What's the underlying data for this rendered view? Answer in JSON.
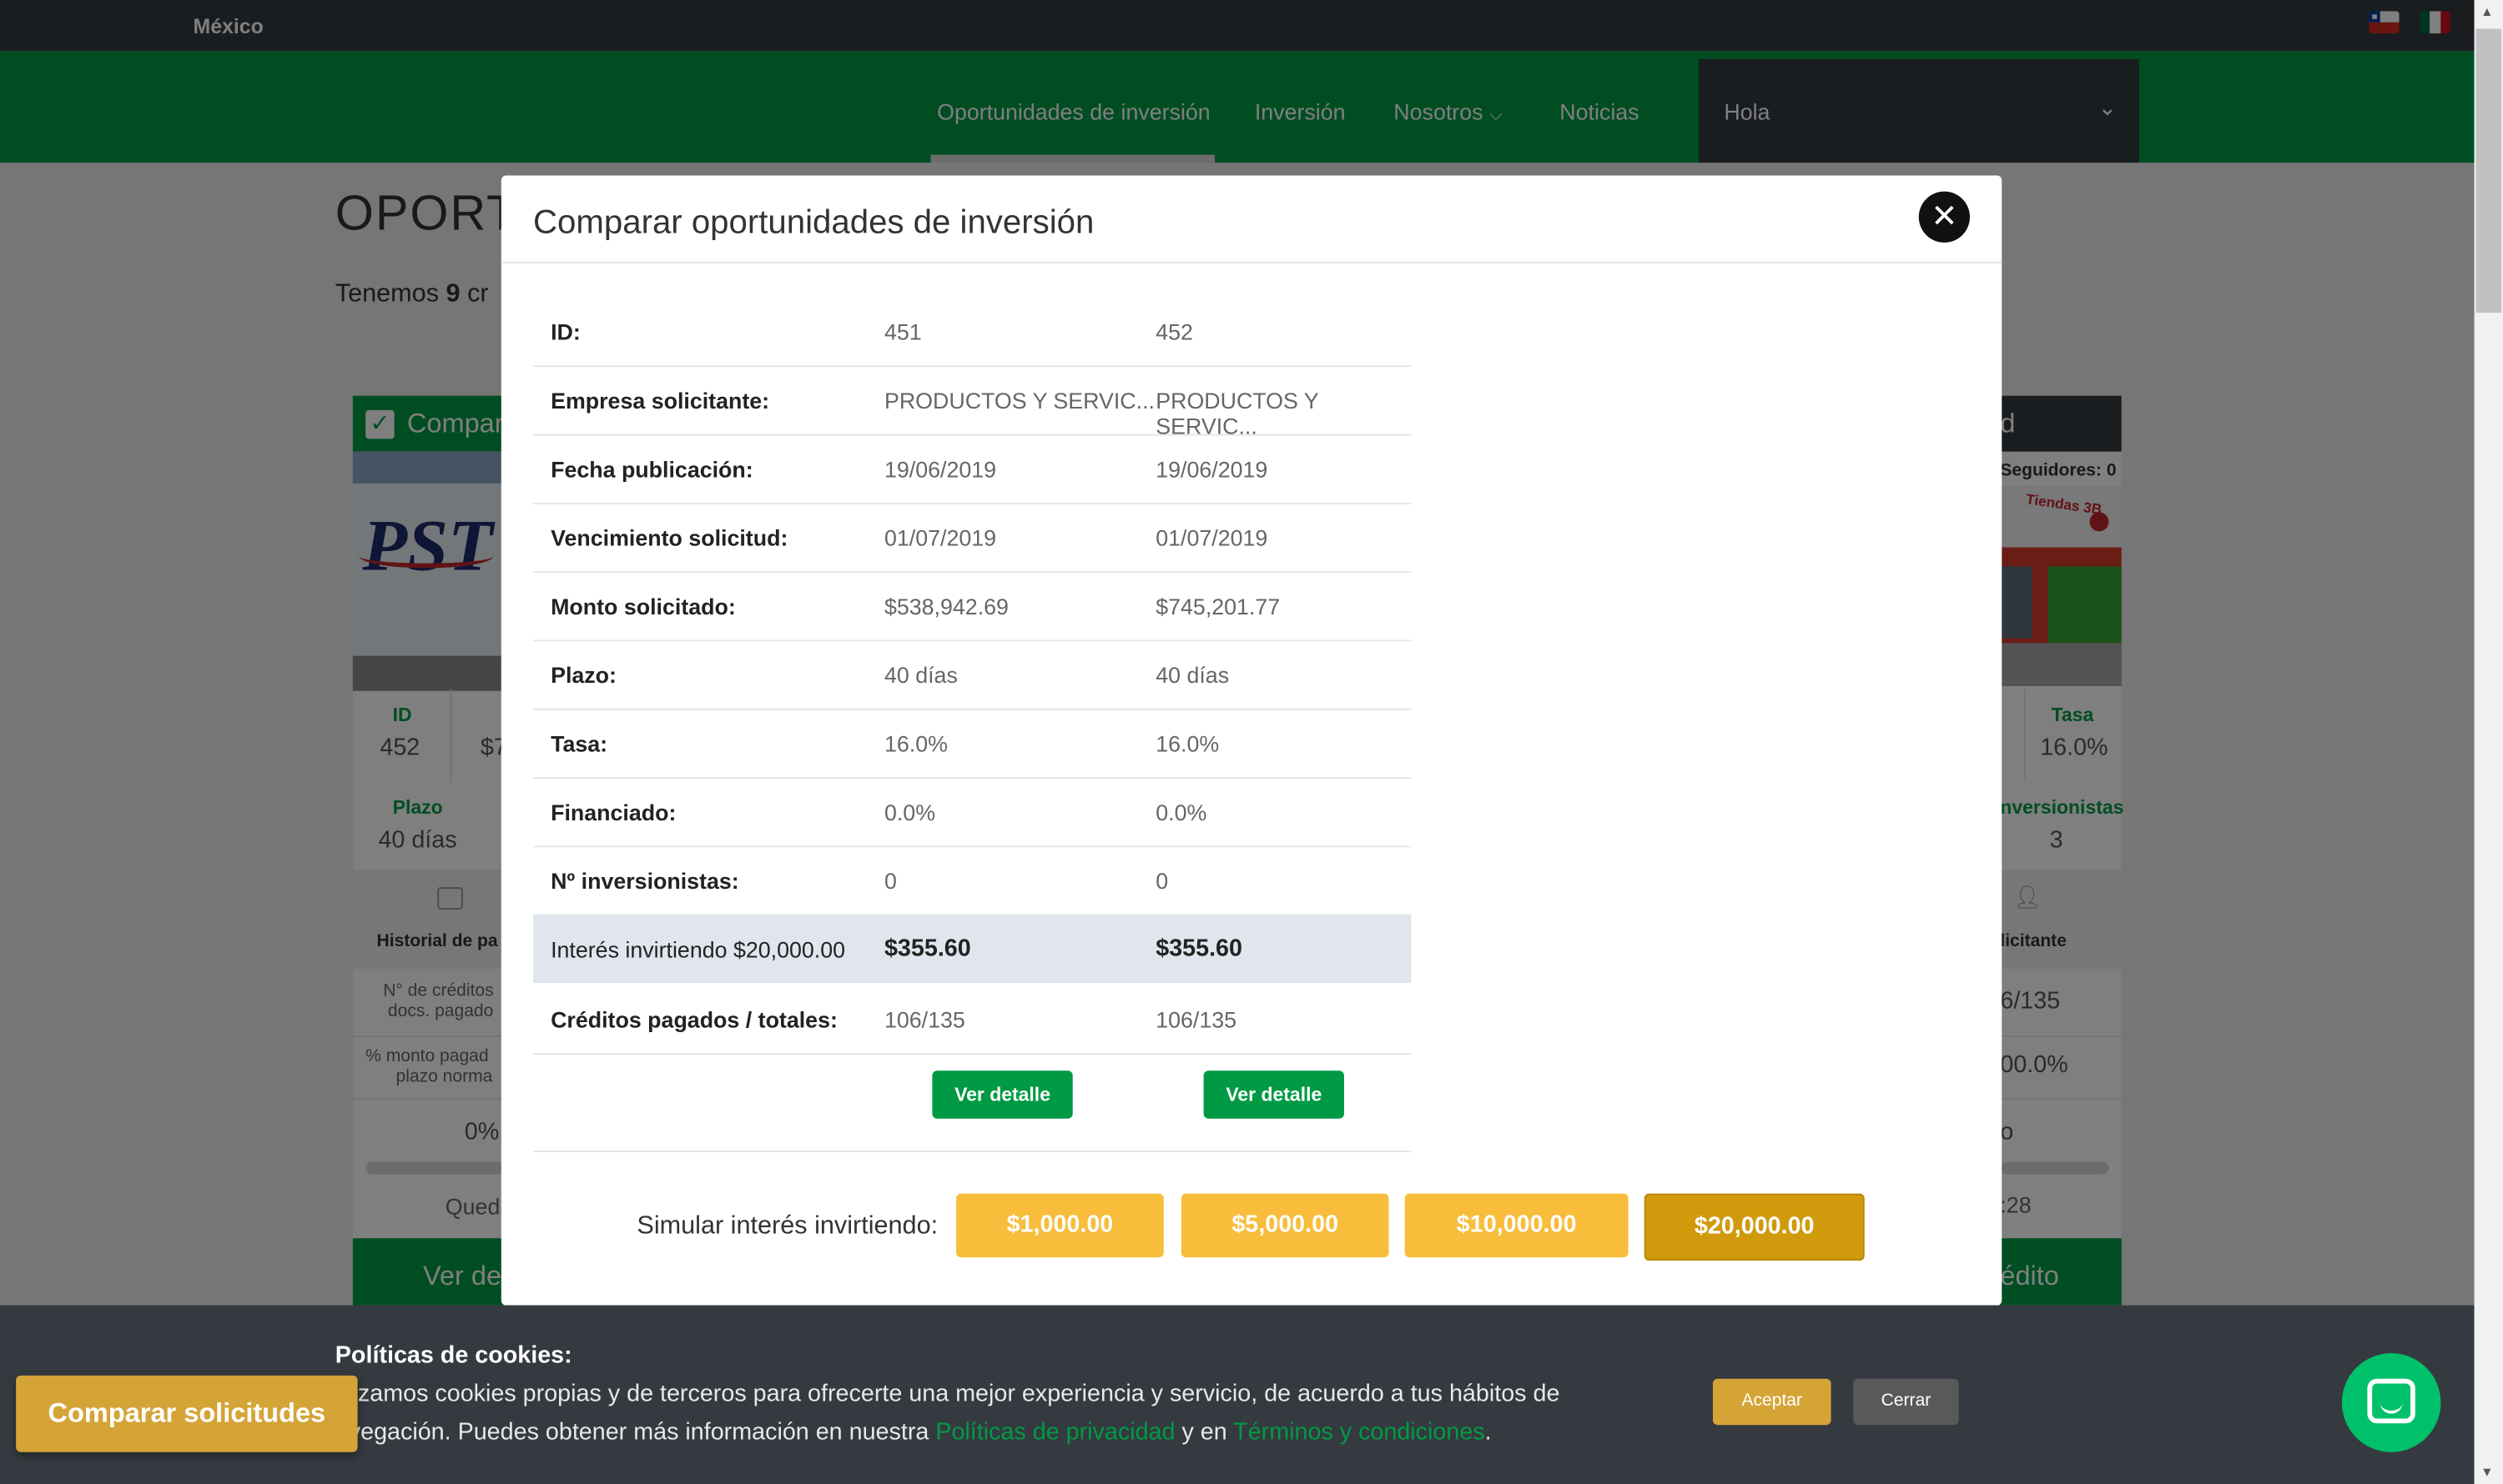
{
  "topbar": {
    "country": "México"
  },
  "nav": {
    "items": [
      {
        "label": "Oportunidades de inversión"
      },
      {
        "label": "Inversión"
      },
      {
        "label": "Nosotros"
      },
      {
        "label": "Noticias"
      }
    ],
    "user_menu_label": "Hola"
  },
  "page": {
    "heading_partial": "OPORT",
    "sub_prefix": "Tenemos ",
    "sub_count": "9",
    "sub_suffix": " cr",
    "left_card": {
      "header": "Compar",
      "id_label": "ID",
      "id_value": "452",
      "amount_partial": "$7",
      "plazo_label": "Plazo",
      "plazo_value": "40 días",
      "historial_label": "Historial de pa",
      "docs_label_1": "N° de créditos",
      "docs_label_2": "docs. pagado",
      "monto_label_1": "% monto pagad",
      "monto_label_2": "plazo norma",
      "percent": "0%",
      "queda": "Queda",
      "ver": "Ver de"
    },
    "right_card": {
      "header": "d",
      "seguidores": "Seguidores: 0",
      "tasa_label": "Tasa",
      "tasa_value": "16.0%",
      "inv_label": "nversionistas",
      "inv_value": "3",
      "solicitante": "licitante",
      "creditos": "6/135",
      "porcentaje": "00.0%",
      "o_text": "o",
      "time": ":28",
      "ver": "édito",
      "storefront_sign": "Tiendas 3B"
    }
  },
  "modal": {
    "title": "Comparar oportunidades de inversión",
    "rows": [
      {
        "label": "ID:",
        "v1": "451",
        "v2": "452"
      },
      {
        "label": "Empresa solicitante:",
        "v1": "PRODUCTOS Y SERVIC...",
        "v2": "PRODUCTOS Y SERVIC..."
      },
      {
        "label": "Fecha publicación:",
        "v1": "19/06/2019",
        "v2": "19/06/2019"
      },
      {
        "label": "Vencimiento solicitud:",
        "v1": "01/07/2019",
        "v2": "01/07/2019"
      },
      {
        "label": "Monto solicitado:",
        "v1": "$538,942.69",
        "v2": "$745,201.77"
      },
      {
        "label": "Plazo:",
        "v1": "40 días",
        "v2": "40 días"
      },
      {
        "label": "Tasa:",
        "v1": "16.0%",
        "v2": "16.0%"
      },
      {
        "label": "Financiado:",
        "v1": "0.0%",
        "v2": "0.0%"
      },
      {
        "label": "Nº inversionistas:",
        "v1": "0",
        "v2": "0"
      },
      {
        "label": "Interés invirtiendo $20,000.00",
        "v1": "$355.60",
        "v2": "$355.60"
      },
      {
        "label": "Créditos pagados / totales:",
        "v1": "106/135",
        "v2": "106/135"
      }
    ],
    "detail_button": "Ver detalle",
    "simulate_label": "Simular interés invirtiendo:",
    "simulate_options": [
      "$1,000.00",
      "$5,000.00",
      "$10,000.00",
      "$20,000.00"
    ],
    "simulate_selected": "$20,000.00"
  },
  "cookies": {
    "title": "Políticas de cookies:",
    "line1": "tilizamos cookies propias y de terceros para ofrecerte una mejor experiencia y servicio, de acuerdo a tus hábitos de",
    "line2_prefix": "avegación. Puedes obtener más información en nuestra ",
    "privacy_link": "Políticas de privacidad",
    "line2_mid": " y en ",
    "terms_link": "Términos y condiciones",
    "line2_suffix": ".",
    "accept": "Aceptar",
    "close": "Cerrar"
  },
  "compare_button": "Comparar solicitudes",
  "colors": {
    "brand_green": "#009a44",
    "dark": "#343a40",
    "gold": "#f7bd3b",
    "gold_active": "#d09a0c",
    "cookie_button": "#d4a437"
  }
}
